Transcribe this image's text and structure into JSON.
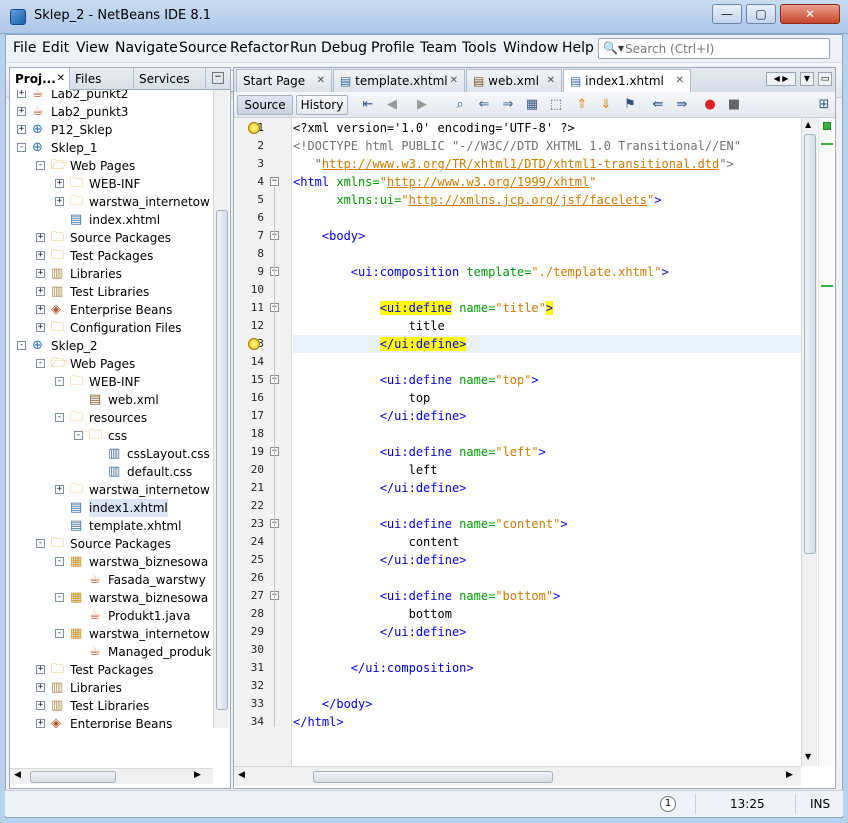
{
  "window": {
    "title": "Sklep_2 - NetBeans IDE 8.1",
    "minimize": "—",
    "maximize": "▢",
    "close": "✕"
  },
  "menu": [
    "File",
    "Edit",
    "View",
    "Navigate",
    "Source",
    "Refactor",
    "Run",
    "Debug",
    "Profile",
    "Team",
    "Tools",
    "Window",
    "Help"
  ],
  "search": {
    "placeholder": "Search (Ctrl+I)"
  },
  "left_panel": {
    "tabs": [
      "Proj...",
      "Files",
      "Services"
    ],
    "tree": [
      {
        "label": "Lab2_punkt2",
        "level": 0,
        "exp": "+",
        "icon": "coffee-project-icon"
      },
      {
        "label": "Lab2_punkt3",
        "level": 0,
        "exp": "+",
        "icon": "coffee-project-icon"
      },
      {
        "label": "P12_Sklep",
        "level": 0,
        "exp": "+",
        "icon": "globe-project-icon"
      },
      {
        "label": "Sklep_1",
        "level": 0,
        "exp": "-",
        "icon": "globe-project-icon"
      },
      {
        "label": "Web Pages",
        "level": 1,
        "exp": "-",
        "icon": "web-folder-icon"
      },
      {
        "label": "WEB-INF",
        "level": 2,
        "exp": "+",
        "icon": "folder-icon"
      },
      {
        "label": "warstwa_internetow",
        "level": 2,
        "exp": "+",
        "icon": "folder-icon"
      },
      {
        "label": "index.xhtml",
        "level": 2,
        "exp": "",
        "icon": "xhtml-file-icon"
      },
      {
        "label": "Source Packages",
        "level": 1,
        "exp": "+",
        "icon": "package-folder-icon"
      },
      {
        "label": "Test Packages",
        "level": 1,
        "exp": "+",
        "icon": "package-folder-icon"
      },
      {
        "label": "Libraries",
        "level": 1,
        "exp": "+",
        "icon": "library-icon"
      },
      {
        "label": "Test Libraries",
        "level": 1,
        "exp": "+",
        "icon": "library-icon"
      },
      {
        "label": "Enterprise Beans",
        "level": 1,
        "exp": "+",
        "icon": "beans-icon"
      },
      {
        "label": "Configuration Files",
        "level": 1,
        "exp": "+",
        "icon": "config-folder-icon"
      },
      {
        "label": "Sklep_2",
        "level": 0,
        "exp": "-",
        "icon": "globe-project-icon"
      },
      {
        "label": "Web Pages",
        "level": 1,
        "exp": "-",
        "icon": "web-folder-icon"
      },
      {
        "label": "WEB-INF",
        "level": 2,
        "exp": "-",
        "icon": "folder-icon"
      },
      {
        "label": "web.xml",
        "level": 3,
        "exp": "",
        "icon": "xml-file-icon"
      },
      {
        "label": "resources",
        "level": 2,
        "exp": "-",
        "icon": "folder-icon"
      },
      {
        "label": "css",
        "level": 3,
        "exp": "-",
        "icon": "folder-icon"
      },
      {
        "label": "cssLayout.css",
        "level": 4,
        "exp": "",
        "icon": "css-file-icon"
      },
      {
        "label": "default.css",
        "level": 4,
        "exp": "",
        "icon": "css-file-icon"
      },
      {
        "label": "warstwa_internetow",
        "level": 2,
        "exp": "+",
        "icon": "folder-icon"
      },
      {
        "label": "index1.xhtml",
        "level": 2,
        "exp": "",
        "icon": "xhtml-file-icon",
        "selected": true
      },
      {
        "label": "template.xhtml",
        "level": 2,
        "exp": "",
        "icon": "xhtml-file-icon"
      },
      {
        "label": "Source Packages",
        "level": 1,
        "exp": "-",
        "icon": "package-folder-icon"
      },
      {
        "label": "warstwa_biznesowa",
        "level": 2,
        "exp": "-",
        "icon": "package-icon"
      },
      {
        "label": "Fasada_warstwy",
        "level": 3,
        "exp": "",
        "icon": "java-file-icon"
      },
      {
        "label": "warstwa_biznesowa",
        "level": 2,
        "exp": "-",
        "icon": "package-icon"
      },
      {
        "label": "Produkt1.java",
        "level": 3,
        "exp": "",
        "icon": "java-file-icon"
      },
      {
        "label": "warstwa_internetow",
        "level": 2,
        "exp": "-",
        "icon": "package-icon"
      },
      {
        "label": "Managed_produk",
        "level": 3,
        "exp": "",
        "icon": "java-file-icon"
      },
      {
        "label": "Test Packages",
        "level": 1,
        "exp": "+",
        "icon": "package-folder-icon"
      },
      {
        "label": "Libraries",
        "level": 1,
        "exp": "+",
        "icon": "library-icon"
      },
      {
        "label": "Test Libraries",
        "level": 1,
        "exp": "+",
        "icon": "library-icon"
      },
      {
        "label": "Enterprise Beans",
        "level": 1,
        "exp": "+",
        "icon": "beans-icon"
      }
    ]
  },
  "editor": {
    "tabs": [
      {
        "label": "Start Page",
        "icon": ""
      },
      {
        "label": "template.xhtml",
        "icon": "xhtml-file-icon"
      },
      {
        "label": "web.xml",
        "icon": "xml-file-icon"
      },
      {
        "label": "index1.xhtml",
        "icon": "xhtml-file-icon",
        "active": true
      }
    ],
    "view_source": "Source",
    "view_history": "History",
    "lines": [
      [
        [
          "t-pi",
          "<?xml version='1.0' encoding='UTF-8' ?>"
        ]
      ],
      [
        [
          "t-dt",
          "<!DOCTYPE html PUBLIC \"-//W3C//DTD XHTML 1.0 Transitional//EN\""
        ]
      ],
      [
        [
          "t-dt",
          "   \""
        ],
        [
          "t-link",
          "http://www.w3.org/TR/xhtml1/DTD/xhtml1-transitional.dtd"
        ],
        [
          "t-dt",
          "\">"
        ]
      ],
      [
        [
          "t-tag",
          "<html "
        ],
        [
          "t-attr",
          "xmlns="
        ],
        [
          "t-val",
          "\""
        ],
        [
          "t-link",
          "http://www.w3.org/1999/xhtml"
        ],
        [
          "t-val",
          "\""
        ]
      ],
      [
        [
          "t-attr",
          "      xmlns:ui="
        ],
        [
          "t-val",
          "\""
        ],
        [
          "t-link",
          "http://xmlns.jcp.org/jsf/facelets"
        ],
        [
          "t-val",
          "\""
        ],
        [
          "t-tag",
          ">"
        ]
      ],
      [],
      [
        [
          "t-tag",
          "    <body>"
        ]
      ],
      [],
      [
        [
          "t-tag",
          "        <ui:composition "
        ],
        [
          "t-attr",
          "template="
        ],
        [
          "t-val",
          "\"./template.xhtml\""
        ],
        [
          "t-tag",
          ">"
        ]
      ],
      [],
      [
        [
          "t-txt",
          "            "
        ],
        [
          "t-tag t-hl",
          "<ui:define"
        ],
        [
          "t-tag",
          " "
        ],
        [
          "t-attr",
          "name="
        ],
        [
          "t-val",
          "\"title\""
        ],
        [
          "t-tag t-hl",
          ">"
        ]
      ],
      [
        [
          "t-txt",
          "                title"
        ]
      ],
      [
        [
          "t-txt",
          "            "
        ],
        [
          "t-tag t-hl",
          "</ui:define>"
        ]
      ],
      [],
      [
        [
          "t-tag",
          "            <ui:define "
        ],
        [
          "t-attr",
          "name="
        ],
        [
          "t-val",
          "\"top\""
        ],
        [
          "t-tag",
          ">"
        ]
      ],
      [
        [
          "t-txt",
          "                top"
        ]
      ],
      [
        [
          "t-tag",
          "            </ui:define>"
        ]
      ],
      [],
      [
        [
          "t-tag",
          "            <ui:define "
        ],
        [
          "t-attr",
          "name="
        ],
        [
          "t-val",
          "\"left\""
        ],
        [
          "t-tag",
          ">"
        ]
      ],
      [
        [
          "t-txt",
          "                left"
        ]
      ],
      [
        [
          "t-tag",
          "            </ui:define>"
        ]
      ],
      [],
      [
        [
          "t-tag",
          "            <ui:define "
        ],
        [
          "t-attr",
          "name="
        ],
        [
          "t-val",
          "\"content\""
        ],
        [
          "t-tag",
          ">"
        ]
      ],
      [
        [
          "t-txt",
          "                content"
        ]
      ],
      [
        [
          "t-tag",
          "            </ui:define>"
        ]
      ],
      [],
      [
        [
          "t-tag",
          "            <ui:define "
        ],
        [
          "t-attr",
          "name="
        ],
        [
          "t-val",
          "\"bottom\""
        ],
        [
          "t-tag",
          ">"
        ]
      ],
      [
        [
          "t-txt",
          "                bottom"
        ]
      ],
      [
        [
          "t-tag",
          "            </ui:define>"
        ]
      ],
      [],
      [
        [
          "t-tag",
          "        </ui:composition>"
        ]
      ],
      [],
      [
        [
          "t-tag",
          "    </body>"
        ]
      ],
      [
        [
          "t-tag",
          "</html>"
        ]
      ]
    ],
    "line_numbers": [
      "1",
      "2",
      "3",
      "4",
      "5",
      "6",
      "7",
      "8",
      "9",
      "10",
      "11",
      "12",
      "13",
      "14",
      "15",
      "16",
      "17",
      "18",
      "19",
      "20",
      "21",
      "22",
      "23",
      "24",
      "25",
      "26",
      "27",
      "28",
      "29",
      "30",
      "31",
      "32",
      "33",
      "34"
    ],
    "fold_markers": [
      4,
      7,
      9,
      11,
      15,
      19,
      23,
      27
    ],
    "hint_lines": [
      1,
      13
    ],
    "current_line": 13
  },
  "status": {
    "position": "13:25",
    "mode": "INS",
    "notifications": "1"
  },
  "colors": {
    "tag": "#0000e6",
    "attribute": "#009900",
    "value": "#ce7b00",
    "highlight": "#ffff00"
  }
}
